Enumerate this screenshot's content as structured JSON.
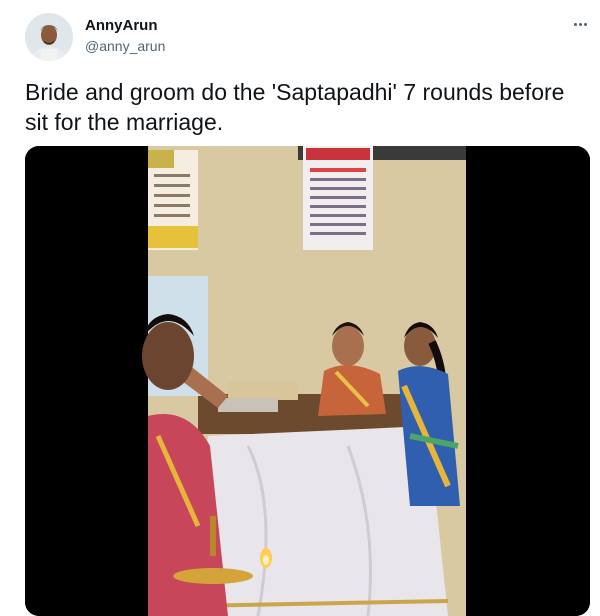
{
  "author": {
    "display_name": "AnnyArun",
    "handle": "@anny_arun",
    "avatar_icon": "user-avatar-icon"
  },
  "more_icon": "more-horizontal-icon",
  "tweet": {
    "text": "Bride and groom do the 'Saptapadhi' 7 rounds before sit for the marriage."
  },
  "media": {
    "type": "video",
    "background": "#000000",
    "wall_color": "#d9c9a3",
    "drape_color": "#e8e6ea"
  }
}
